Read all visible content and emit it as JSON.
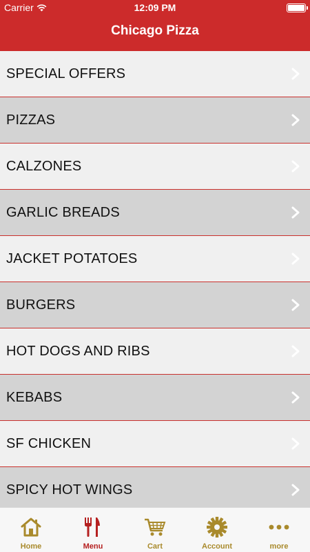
{
  "status_bar": {
    "carrier": "Carrier",
    "time": "12:09 PM"
  },
  "header": {
    "title": "Chicago Pizza"
  },
  "menu": {
    "items": [
      {
        "label": "SPECIAL OFFERS"
      },
      {
        "label": "PIZZAS"
      },
      {
        "label": "CALZONES"
      },
      {
        "label": "GARLIC BREADS"
      },
      {
        "label": "JACKET POTATOES"
      },
      {
        "label": "BURGERS"
      },
      {
        "label": "HOT DOGS AND RIBS"
      },
      {
        "label": "KEBABS"
      },
      {
        "label": "SF CHICKEN"
      },
      {
        "label": "SPICY HOT WINGS"
      }
    ]
  },
  "tabbar": {
    "tabs": [
      {
        "label": "Home",
        "icon": "home-icon"
      },
      {
        "label": "Menu",
        "icon": "cutlery-icon",
        "active": true
      },
      {
        "label": "Cart",
        "icon": "cart-icon"
      },
      {
        "label": "Account",
        "icon": "gear-icon"
      },
      {
        "label": "more",
        "icon": "more-icon"
      }
    ]
  },
  "colors": {
    "brand_red": "#cc2b2b",
    "tab_gold": "#a98a2c",
    "tab_active": "#b52020"
  }
}
